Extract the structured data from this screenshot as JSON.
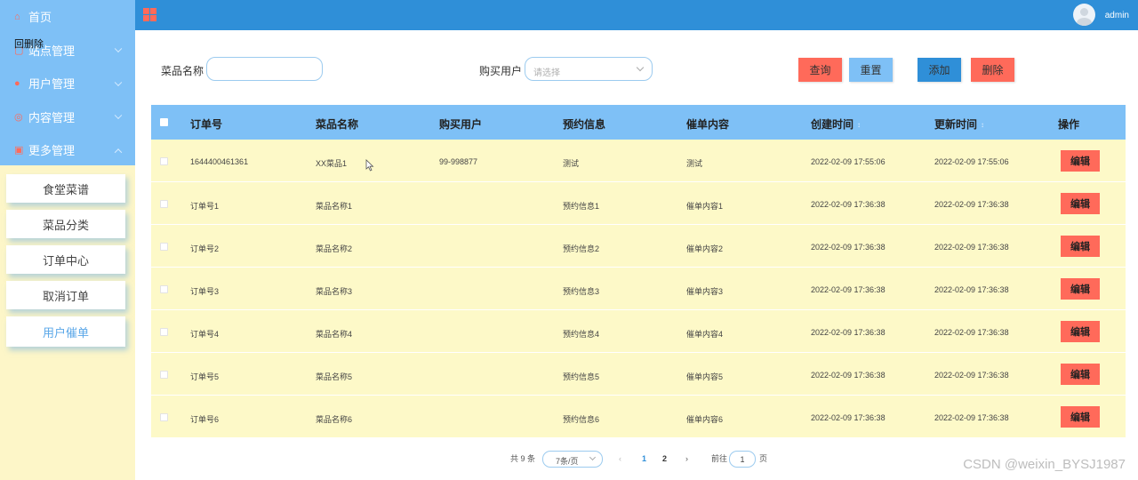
{
  "sidebar": {
    "items": [
      {
        "label": "首页",
        "icon": "home-icon",
        "has_arrow": false
      },
      {
        "label": "站点管理",
        "icon": "site-icon",
        "has_arrow": true
      },
      {
        "label": "用户管理",
        "icon": "user-icon",
        "has_arrow": true
      },
      {
        "label": "内容管理",
        "icon": "content-icon",
        "has_arrow": true
      },
      {
        "label": "更多管理",
        "icon": "more-icon",
        "has_arrow": true
      }
    ],
    "overlay_text": "回删除",
    "submenu": [
      {
        "label": "食堂菜谱"
      },
      {
        "label": "菜品分类"
      },
      {
        "label": "订单中心"
      },
      {
        "label": "取消订单"
      },
      {
        "label": "用户催单",
        "active": true
      }
    ]
  },
  "header": {
    "user": "admin"
  },
  "search": {
    "dish_label": "菜品名称",
    "dish_value": "",
    "buyer_label": "购买用户",
    "buyer_placeholder": "请选择",
    "query_btn": "查询",
    "reset_btn": "重置",
    "add_btn": "添加",
    "delete_btn": "删除"
  },
  "table": {
    "headers": [
      "订单号",
      "菜品名称",
      "购买用户",
      "预约信息",
      "催单内容",
      "创建时间",
      "更新时间",
      "操作"
    ],
    "edit_label": "编辑",
    "rows": [
      {
        "order": "1644400461361",
        "dish": "XX菜品1",
        "buyer": "99-998877",
        "reserve": "测试",
        "urge": "测试",
        "created": "2022-02-09 17:55:06",
        "updated": "2022-02-09 17:55:06"
      },
      {
        "order": "订单号1",
        "dish": "菜品名称1",
        "buyer": "",
        "reserve": "预约信息1",
        "urge": "催单内容1",
        "created": "2022-02-09 17:36:38",
        "updated": "2022-02-09 17:36:38"
      },
      {
        "order": "订单号2",
        "dish": "菜品名称2",
        "buyer": "",
        "reserve": "预约信息2",
        "urge": "催单内容2",
        "created": "2022-02-09 17:36:38",
        "updated": "2022-02-09 17:36:38"
      },
      {
        "order": "订单号3",
        "dish": "菜品名称3",
        "buyer": "",
        "reserve": "预约信息3",
        "urge": "催单内容3",
        "created": "2022-02-09 17:36:38",
        "updated": "2022-02-09 17:36:38"
      },
      {
        "order": "订单号4",
        "dish": "菜品名称4",
        "buyer": "",
        "reserve": "预约信息4",
        "urge": "催单内容4",
        "created": "2022-02-09 17:36:38",
        "updated": "2022-02-09 17:36:38"
      },
      {
        "order": "订单号5",
        "dish": "菜品名称5",
        "buyer": "",
        "reserve": "预约信息5",
        "urge": "催单内容5",
        "created": "2022-02-09 17:36:38",
        "updated": "2022-02-09 17:36:38"
      },
      {
        "order": "订单号6",
        "dish": "菜品名称6",
        "buyer": "",
        "reserve": "预约信息6",
        "urge": "催单内容6",
        "created": "2022-02-09 17:36:38",
        "updated": "2022-02-09 17:36:38"
      }
    ]
  },
  "pagination": {
    "total_text": "共 9 条",
    "page_size": "7条/页",
    "prev": "‹",
    "pages": [
      "1",
      "2"
    ],
    "current_page": "1",
    "next": "›",
    "goto_label": "前往",
    "goto_value": "1",
    "page_suffix": "页"
  },
  "watermark": "CSDN @weixin_BYSJ1987",
  "colors": {
    "sidebar_menu": "#7ec0f6",
    "sidebar_bg": "#fdf6c8",
    "header": "#2f8fd8",
    "accent_red": "#ff6a5a",
    "row_bg": "#fdf9c8"
  }
}
